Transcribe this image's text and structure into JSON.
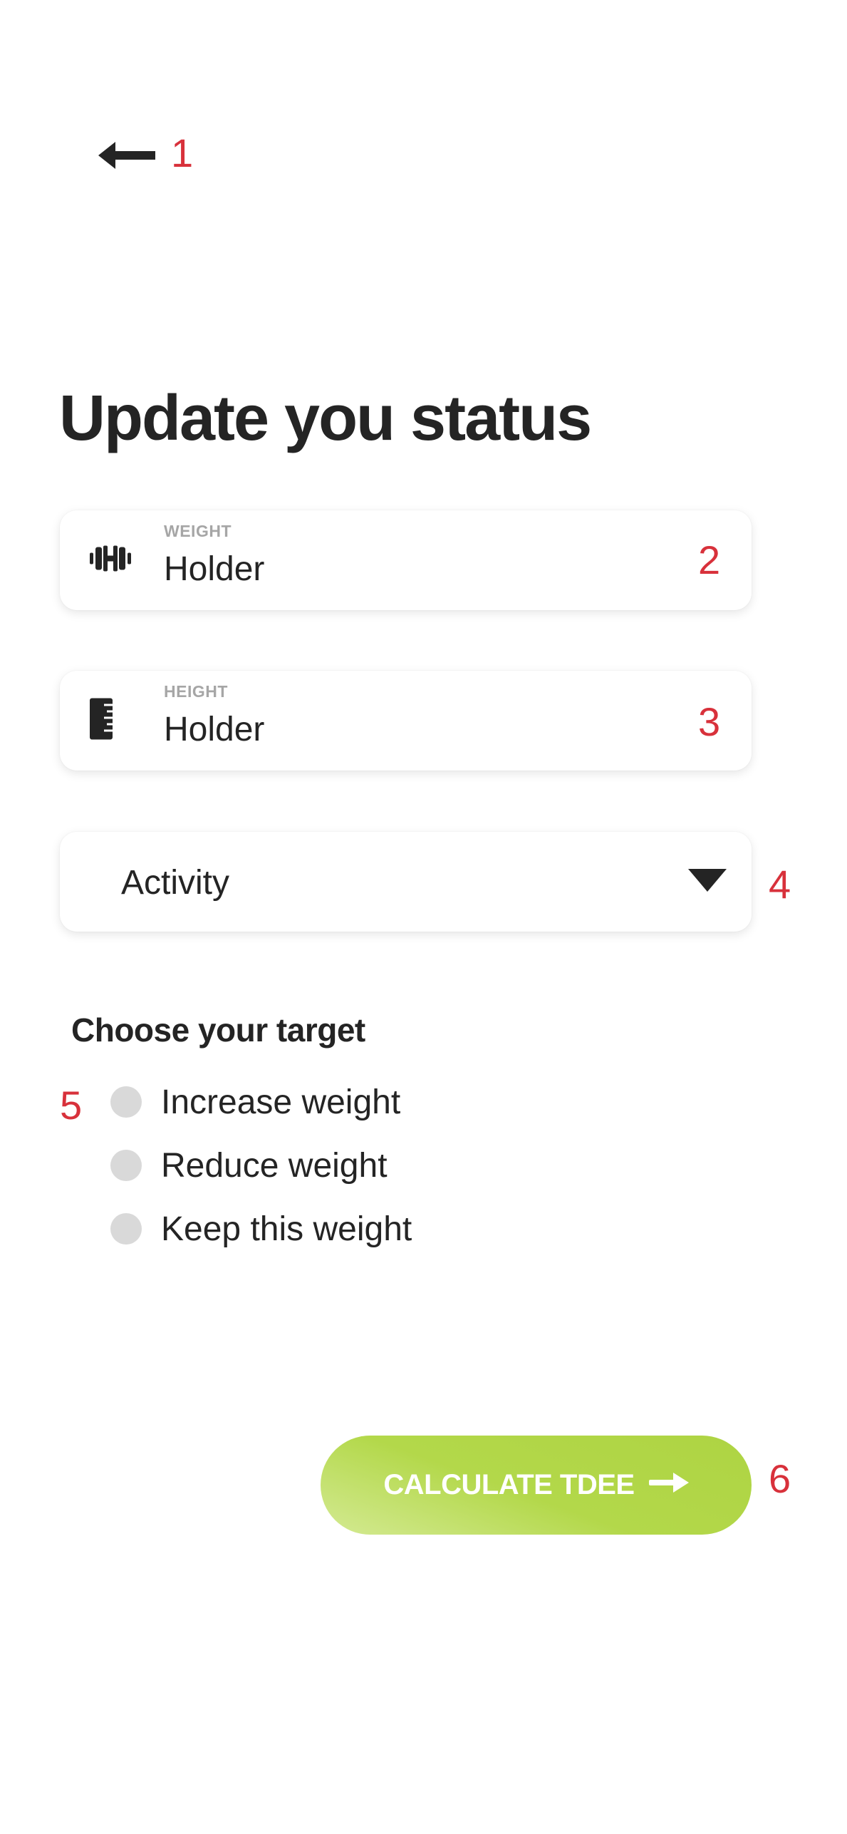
{
  "header": {
    "back_icon": "arrow-left-icon",
    "annotation": "1"
  },
  "title": "Update you status",
  "fields": {
    "weight": {
      "label": "WEIGHT",
      "value": "",
      "placeholder": "Holder",
      "icon": "dumbbell-icon",
      "annotation": "2"
    },
    "height": {
      "label": "HEIGHT",
      "value": "",
      "placeholder": "Holder",
      "icon": "ruler-icon",
      "annotation": "3"
    }
  },
  "activity": {
    "value": "Activity",
    "icon": "caret-down-icon",
    "annotation": "4"
  },
  "target": {
    "title": "Choose your target",
    "annotation": "5",
    "options": [
      {
        "label": "Increase weight",
        "selected": false
      },
      {
        "label": "Reduce weight",
        "selected": false
      },
      {
        "label": "Keep this weight",
        "selected": false
      }
    ]
  },
  "cta": {
    "label": "CALCULATE TDEE",
    "icon": "arrow-right-icon",
    "annotation": "6"
  },
  "colors": {
    "accent": "#b3d84a",
    "accent_light": "#d4ea93",
    "annotation": "#d8313b",
    "text": "#242424",
    "muted": "#a6a6a6",
    "radio": "#d9d9d9"
  }
}
